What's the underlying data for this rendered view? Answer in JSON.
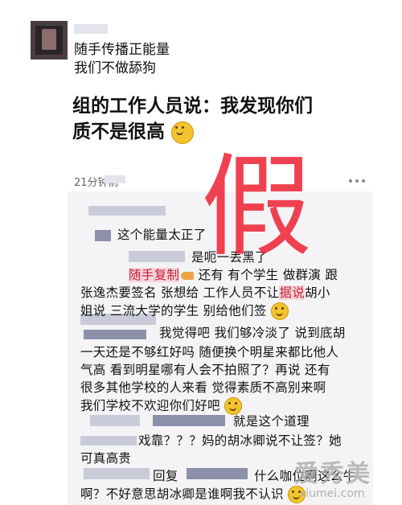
{
  "post": {
    "line1": "随手传播正能量",
    "line2": "我们不做舔狗",
    "quote_line1": "组的工作人员说：我发现你们",
    "quote_line2": "质不是很高",
    "time": "21分钟前"
  },
  "comments": {
    "c1": "这个能量太正了",
    "c2": "是呃一丢黑了",
    "c3_hl": "随手复制",
    "c3": "还有 有个学生 做群演 跟",
    "c4": "张逸杰要签名 张想给 工作人员不让",
    "c4_hl": "据说",
    "c4_tail": "胡小",
    "c5": "姐说 三流大学的学生 别给他们签",
    "c6": "我觉得吧 我们够冷淡了 说到底胡",
    "c7": "一天还是不够红好吗 随便换个明星来都比他人",
    "c8": "气高 看到明星哪有人会不拍照了？再说 还有",
    "c9": "很多其他学校的人来看 觉得素质不高别来啊",
    "c10": "我们学校不欢迎你们好吧",
    "c11": "就是这个道理",
    "c12": "戏靠？？？妈的胡冰卿说不让签？她",
    "c13": "可真高贵",
    "c14a": "回复",
    "c14b": "什么咖位啊这么牛",
    "c15": "啊？不好意思胡冰卿是谁啊我不认识"
  },
  "stamp_text": "假",
  "watermark": {
    "text": "爱秀美",
    "url": "xiumei.com"
  },
  "icons": {
    "avatar": "avatar-photo",
    "more": "more-dots-icon",
    "emoji": "smile-emoji-icon",
    "hand": "pointing-hand-emoji-icon"
  }
}
